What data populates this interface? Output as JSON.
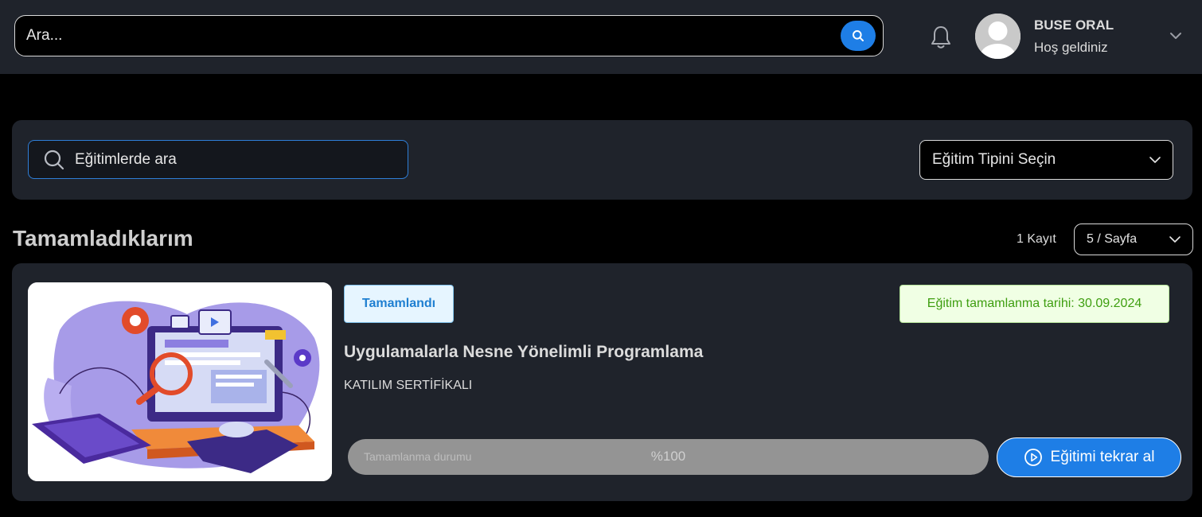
{
  "header": {
    "search_placeholder": "Ara...",
    "icons": {
      "search": "search-icon",
      "notifications": "bell-icon",
      "menu": "chevron-down-icon"
    },
    "user": {
      "name": "BUSE ORAL",
      "greeting": "Hoş geldiniz"
    }
  },
  "filters": {
    "search_placeholder": "Eğitimlerde ara",
    "type_select": "Eğitim Tipini Seçin"
  },
  "section": {
    "title": "Tamamladıklarım",
    "record_count": "1 Kayıt",
    "page_size": "5 / Sayfa"
  },
  "courses": [
    {
      "status": "Tamamlandı",
      "completion_date": "Eğitim tamamlanma tarihi: 30.09.2024",
      "title": "Uygulamalarla Nesne Yönelimli Programlama",
      "certificate": "KATILIM SERTİFİKALI",
      "progress_label": "Tamamlanma durumu",
      "progress_text": "%100",
      "progress_value": 100,
      "action": "Eğitimi tekrar al"
    }
  ],
  "colors": {
    "accent": "#1e7ee6",
    "panel": "#1f232b",
    "success_text": "#3e9e10",
    "status_text": "#1f7fd1"
  }
}
